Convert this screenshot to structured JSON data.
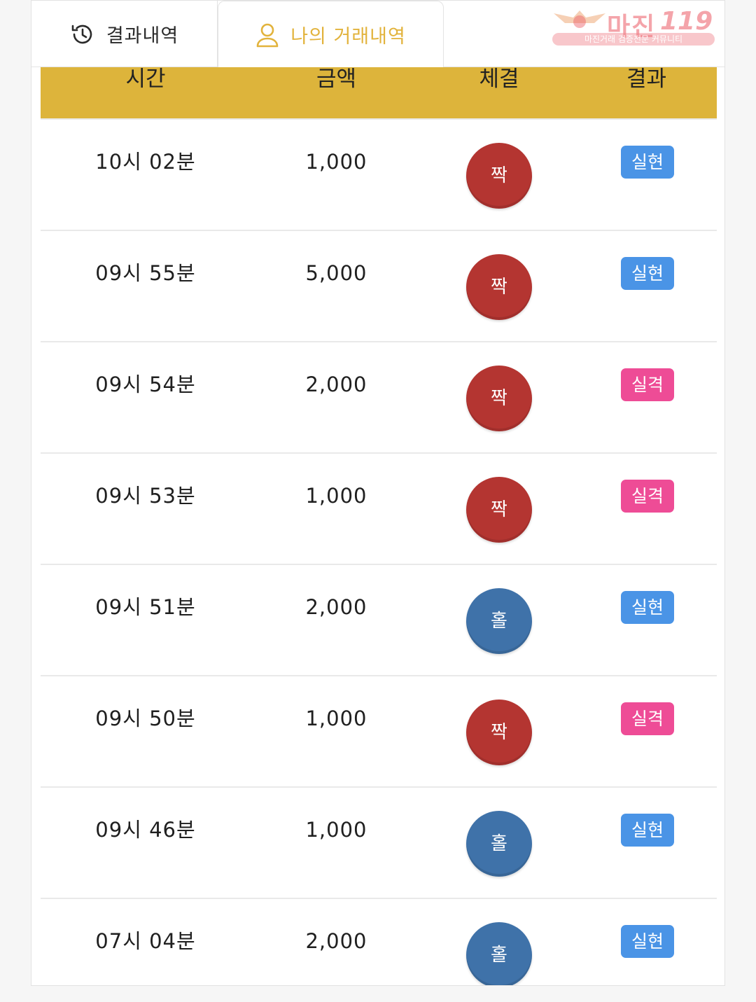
{
  "tabs": {
    "results_label": "결과내역",
    "mine_label": "나의 거래내역",
    "active": "mine"
  },
  "watermark": {
    "brand": "마진",
    "number": "119",
    "subtitle": "마진거래 검증전문 커뮤니티"
  },
  "table": {
    "headers": {
      "time": "시간",
      "amount": "금액",
      "side": "체결",
      "result": "결과"
    },
    "rows": [
      {
        "time": "10시 02분",
        "amount": "1,000",
        "side": "짝",
        "result": "실현"
      },
      {
        "time": "09시 55분",
        "amount": "5,000",
        "side": "짝",
        "result": "실현"
      },
      {
        "time": "09시 54분",
        "amount": "2,000",
        "side": "짝",
        "result": "실격"
      },
      {
        "time": "09시 53분",
        "amount": "1,000",
        "side": "짝",
        "result": "실격"
      },
      {
        "time": "09시 51분",
        "amount": "2,000",
        "side": "홀",
        "result": "실현"
      },
      {
        "time": "09시 50분",
        "amount": "1,000",
        "side": "짝",
        "result": "실격"
      },
      {
        "time": "09시 46분",
        "amount": "1,000",
        "side": "홀",
        "result": "실현"
      },
      {
        "time": "07시 04분",
        "amount": "2,000",
        "side": "홀",
        "result": "실현"
      }
    ]
  },
  "colors": {
    "header_bg": "#ddb43b",
    "active_tab": "#e2b33c",
    "even_chip": "#b43531",
    "odd_chip": "#3f72a9",
    "result_hit": "#4a94e6",
    "result_miss": "#ee4c96"
  },
  "icons": {
    "results_tab": "history-icon",
    "mine_tab": "user-icon"
  }
}
